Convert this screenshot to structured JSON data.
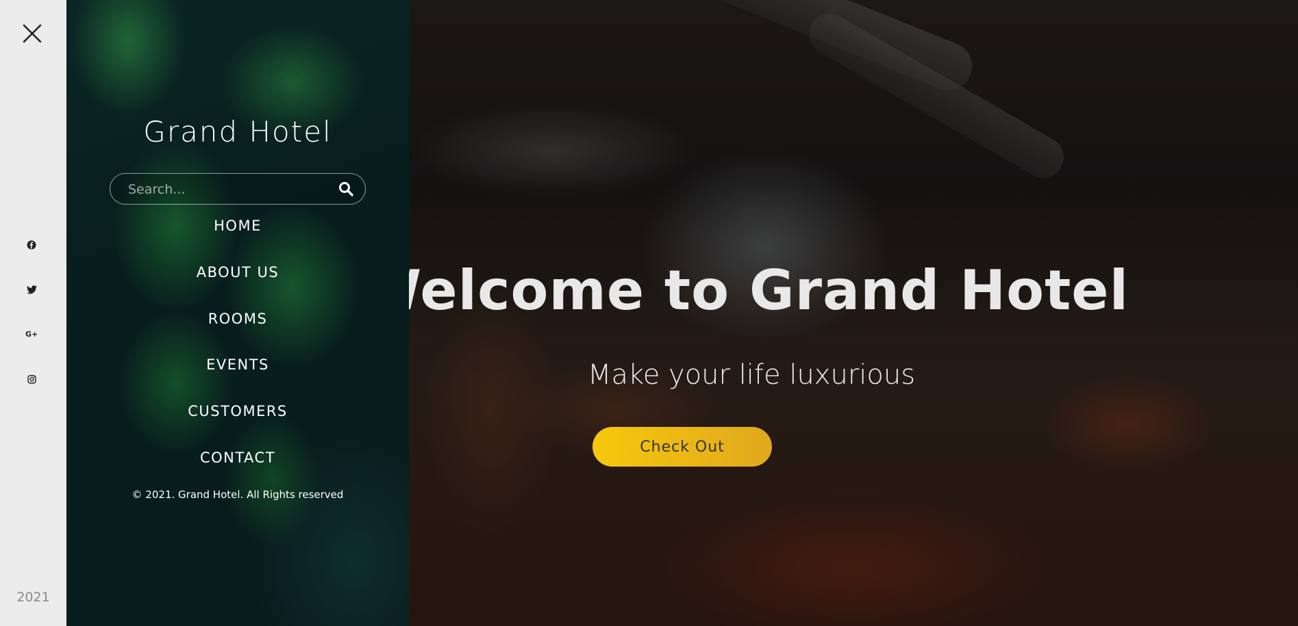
{
  "rail": {
    "year": "2021",
    "social": [
      "facebook-icon",
      "twitter-icon",
      "google-plus-icon",
      "instagram-icon"
    ]
  },
  "panel": {
    "brand": "Grand Hotel",
    "search": {
      "placeholder": "Search..."
    },
    "nav": [
      {
        "label": "HOME"
      },
      {
        "label": "ABOUT US"
      },
      {
        "label": "ROOMS"
      },
      {
        "label": "EVENTS"
      },
      {
        "label": "CUSTOMERS"
      },
      {
        "label": "CONTACT"
      }
    ],
    "copyright": "© 2021. Grand Hotel. All Rights reserved"
  },
  "hero": {
    "title": "Welcome to Grand Hotel",
    "subtitle": "Make your life luxurious",
    "cta_label": "Check Out",
    "accent": "#f5c518"
  }
}
